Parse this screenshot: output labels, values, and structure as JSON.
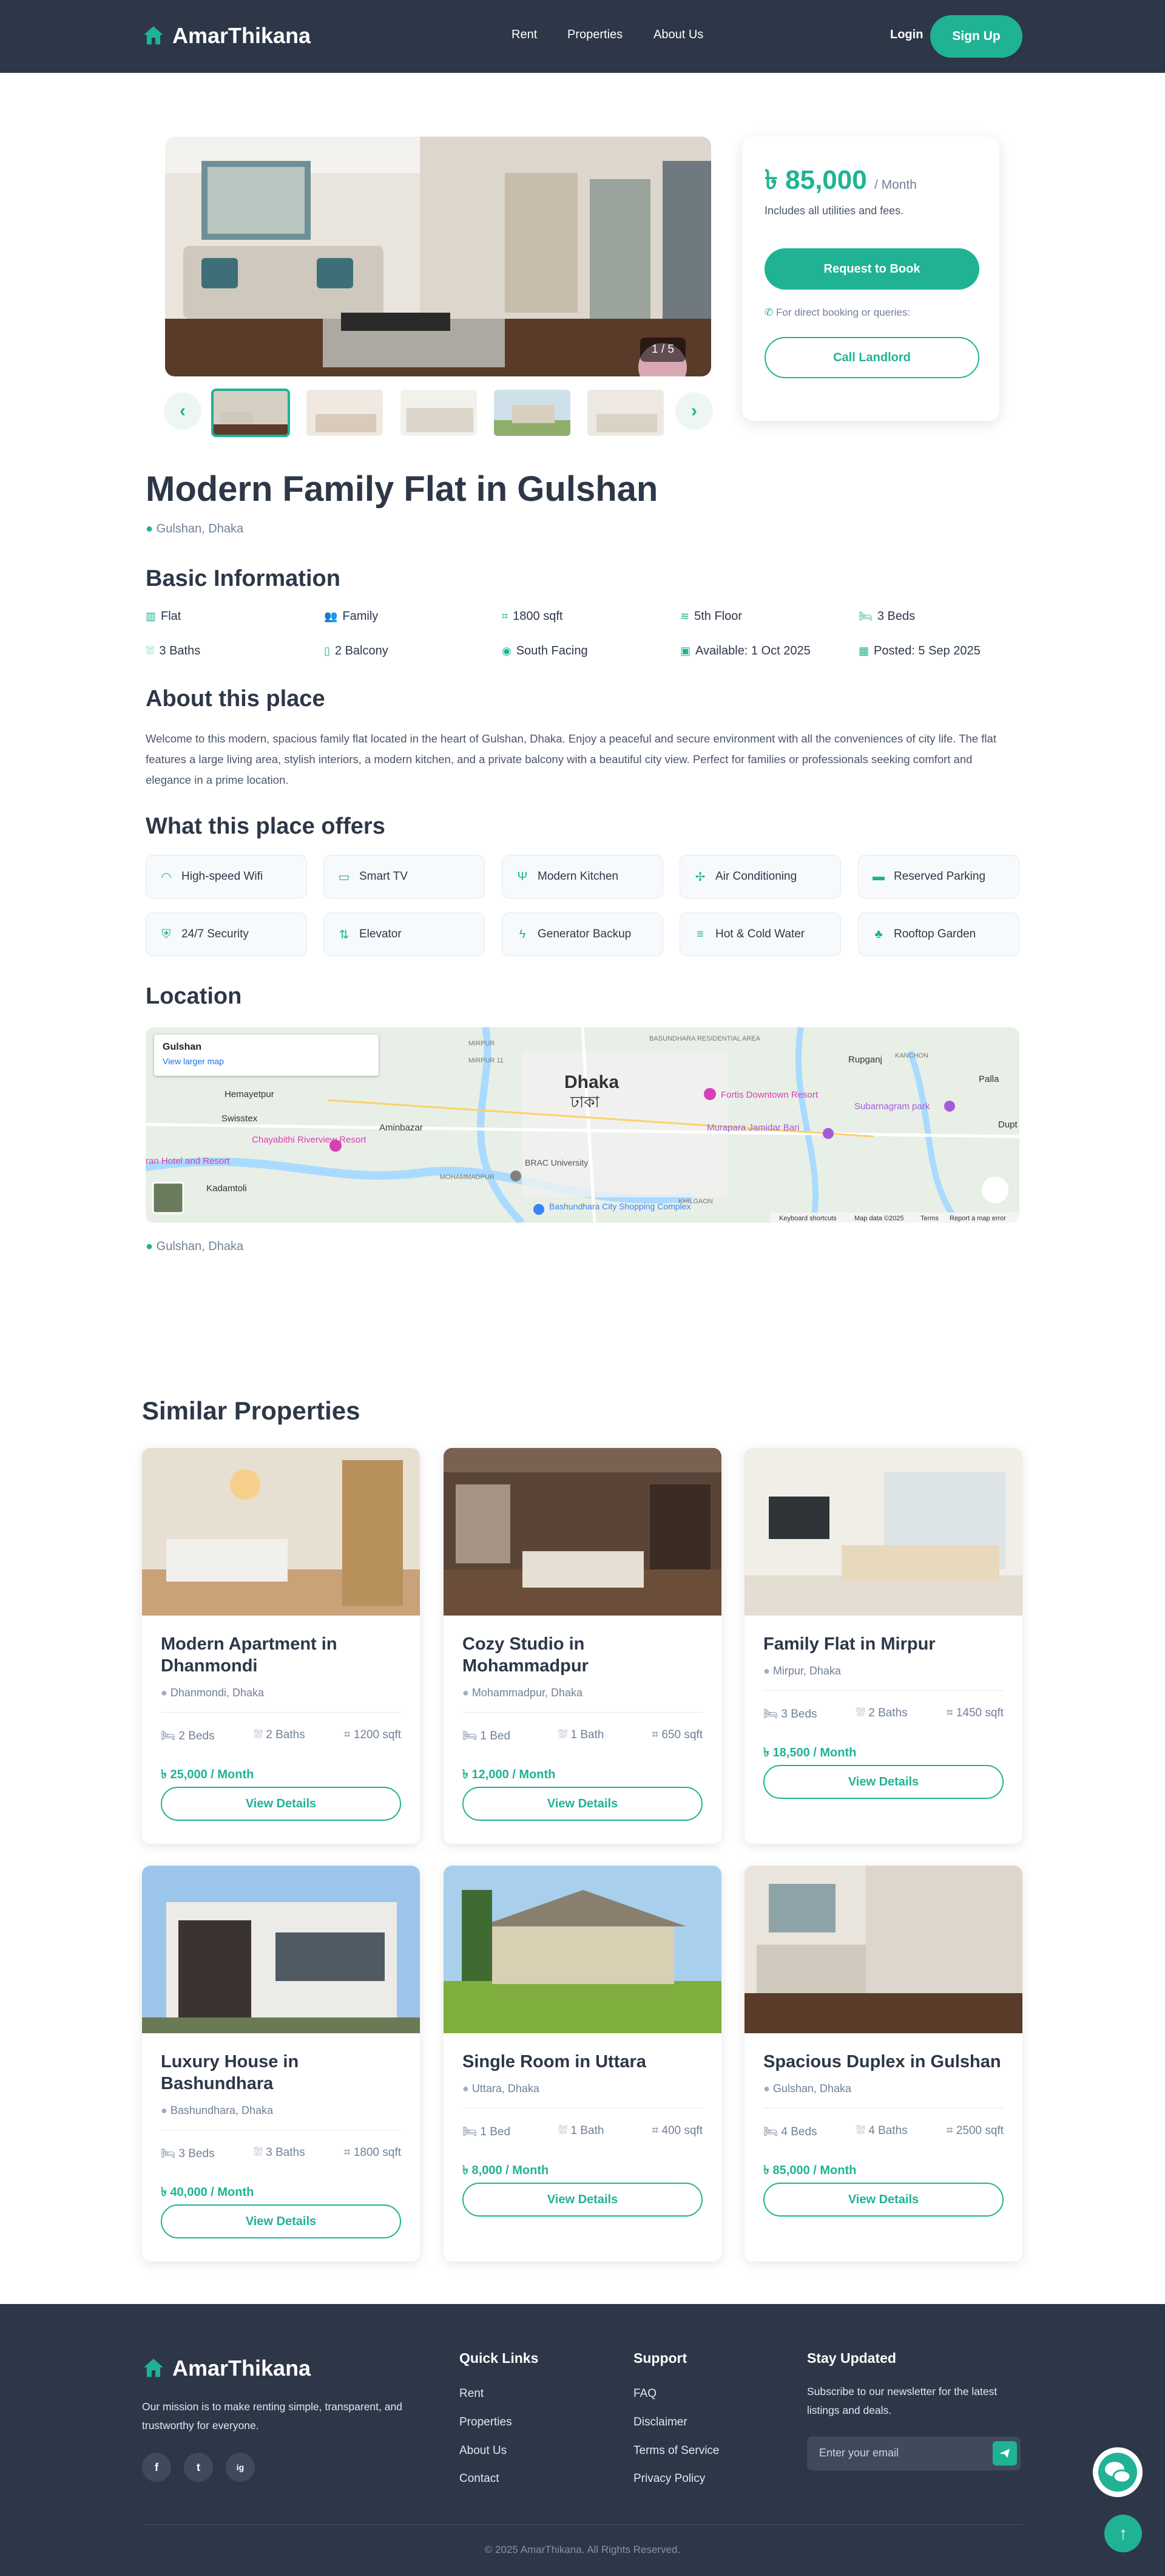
{
  "header": {
    "brand": "AmarThikana",
    "nav": [
      "Rent",
      "Properties",
      "About Us"
    ],
    "login": "Login",
    "signup": "Sign Up"
  },
  "gallery": {
    "counter": "1 / 5"
  },
  "booking": {
    "price": "৳ 85,000",
    "per": "/ Month",
    "includes": "Includes all utilities and fees.",
    "request": "Request to Book",
    "direct": "For direct booking or queries:",
    "call": "Call Landlord"
  },
  "property": {
    "title": "Modern Family Flat in Gulshan",
    "location": "Gulshan, Dhaka"
  },
  "basic": {
    "heading": "Basic Information",
    "items": [
      "Flat",
      "Family",
      "1800 sqft",
      "5th Floor",
      "3 Beds",
      "3 Baths",
      "2 Balcony",
      "South Facing",
      "Available: 1 Oct 2025",
      "Posted: 5 Sep 2025"
    ]
  },
  "about": {
    "heading": "About this place",
    "text": "Welcome to this modern, spacious family flat located in the heart of Gulshan, Dhaka. Enjoy a peaceful and secure environment with all the conveniences of city life. The flat features a large living area, stylish interiors, a modern kitchen, and a private balcony with a beautiful city view. Perfect for families or professionals seeking comfort and elegance in a prime location."
  },
  "offers": {
    "heading": "What this place offers",
    "items": [
      "High-speed Wifi",
      "Smart TV",
      "Modern Kitchen",
      "Air Conditioning",
      "Reserved Parking",
      "24/7 Security",
      "Elevator",
      "Generator Backup",
      "Hot & Cold Water",
      "Rooftop Garden"
    ]
  },
  "location": {
    "heading": "Location",
    "map_title": "Gulshan",
    "map_link": "View larger map",
    "map_city": "Dhaka",
    "map_city_bn": "ঢাকা",
    "map_places": [
      "Hemayetpur",
      "Swisstex",
      "Aminbazar",
      "Chayabithi Riverview Resort",
      "Kadamtoli",
      "BRAC University",
      "Bashundhara City Shopping Complex",
      "Fortis Downtown Resort",
      "Murapara Jamidar Bari",
      "Rupganj",
      "Subarnagram park",
      "Palla",
      "Dupt",
      "KANCHON",
      "MIRPUR",
      "MIRPUR 11",
      "BASUNDHARA RESIDENTIAL AREA",
      "MOHAMMADPUR",
      "KHILGAON",
      "ran Hotel and Resort"
    ],
    "map_footer": [
      "Keyboard shortcuts",
      "Map data ©2025",
      "Terms",
      "Report a map error"
    ],
    "footer_loc": "Gulshan, Dhaka"
  },
  "similar": {
    "heading": "Similar Properties",
    "view": "View Details",
    "cards": [
      {
        "title": "Modern Apartment in Dhanmondi",
        "loc": "Dhanmondi, Dhaka",
        "beds": "2 Beds",
        "baths": "2 Baths",
        "area": "1200 sqft",
        "price": "৳ 25,000 / Month"
      },
      {
        "title": "Cozy Studio in Mohammadpur",
        "loc": "Mohammadpur, Dhaka",
        "beds": "1 Bed",
        "baths": "1 Bath",
        "area": "650 sqft",
        "price": "৳ 12,000 / Month"
      },
      {
        "title": "Family Flat in Mirpur",
        "loc": "Mirpur, Dhaka",
        "beds": "3 Beds",
        "baths": "2 Baths",
        "area": "1450 sqft",
        "price": "৳ 18,500 / Month"
      },
      {
        "title": "Luxury House in Bashundhara",
        "loc": "Bashundhara, Dhaka",
        "beds": "3 Beds",
        "baths": "3 Baths",
        "area": "1800 sqft",
        "price": "৳ 40,000 / Month"
      },
      {
        "title": "Single Room in Uttara",
        "loc": "Uttara, Dhaka",
        "beds": "1 Bed",
        "baths": "1 Bath",
        "area": "400 sqft",
        "price": "৳ 8,000 / Month"
      },
      {
        "title": "Spacious Duplex in Gulshan",
        "loc": "Gulshan, Dhaka",
        "beds": "4 Beds",
        "baths": "4 Baths",
        "area": "2500 sqft",
        "price": "৳ 85,000 / Month"
      }
    ]
  },
  "footer": {
    "brand": "AmarThikana",
    "mission": "Our mission is to make renting simple, transparent, and trustworthy for everyone.",
    "social": [
      "f",
      "t",
      "ig"
    ],
    "quick_heading": "Quick Links",
    "quick": [
      "Rent",
      "Properties",
      "About Us",
      "Contact"
    ],
    "support_heading": "Support",
    "support": [
      "FAQ",
      "Disclaimer",
      "Terms of Service",
      "Privacy Policy"
    ],
    "stay_heading": "Stay Updated",
    "stay_text": "Subscribe to our newsletter for the latest listings and deals.",
    "email_placeholder": "Enter your email",
    "copyright": "© 2025 AmarThikana. All Rights Reserved."
  },
  "colors": {
    "primary": "#1fb394",
    "dark": "#2d3748"
  }
}
